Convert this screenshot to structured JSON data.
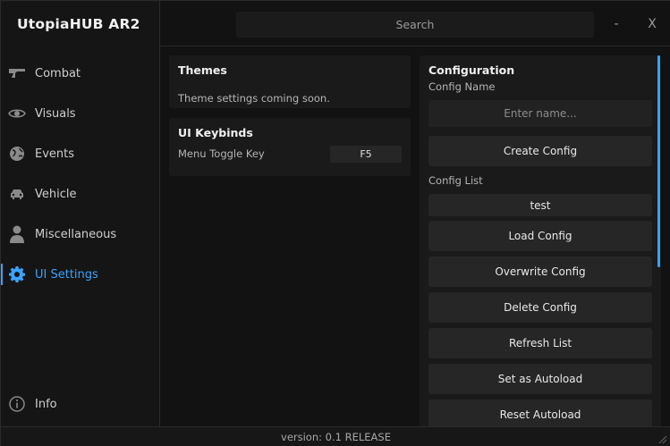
{
  "app": {
    "title": "UtopiaHUB AR2"
  },
  "topbar": {
    "search_placeholder": "Search",
    "minimize_label": "-",
    "close_label": "X"
  },
  "sidebar": {
    "items": [
      {
        "label": "Combat",
        "icon": "gun-icon"
      },
      {
        "label": "Visuals",
        "icon": "eye-icon"
      },
      {
        "label": "Events",
        "icon": "globe-icon"
      },
      {
        "label": "Vehicle",
        "icon": "car-icon"
      },
      {
        "label": "Miscellaneous",
        "icon": "person-icon"
      },
      {
        "label": "UI Settings",
        "icon": "gear-icon",
        "active": true
      }
    ],
    "info_label": "Info"
  },
  "themes": {
    "title": "Themes",
    "text": "Theme settings coming soon."
  },
  "keybinds": {
    "title": "UI Keybinds",
    "menu_toggle_label": "Menu Toggle Key",
    "menu_toggle_value": "F5"
  },
  "configuration": {
    "title": "Configuration",
    "name_label": "Config Name",
    "name_placeholder": "Enter name...",
    "create_label": "Create Config",
    "list_label": "Config List",
    "list": [
      "test"
    ],
    "load_label": "Load Config",
    "overwrite_label": "Overwrite Config",
    "delete_label": "Delete Config",
    "refresh_label": "Refresh List",
    "autoload_label": "Set as Autoload",
    "reset_autoload_label": "Reset Autoload"
  },
  "footer": {
    "version": "version: 0.1 RELEASE"
  },
  "colors": {
    "accent": "#3aa3ff",
    "background": "#121212",
    "panel": "#1a1a1a",
    "button": "#262626"
  }
}
